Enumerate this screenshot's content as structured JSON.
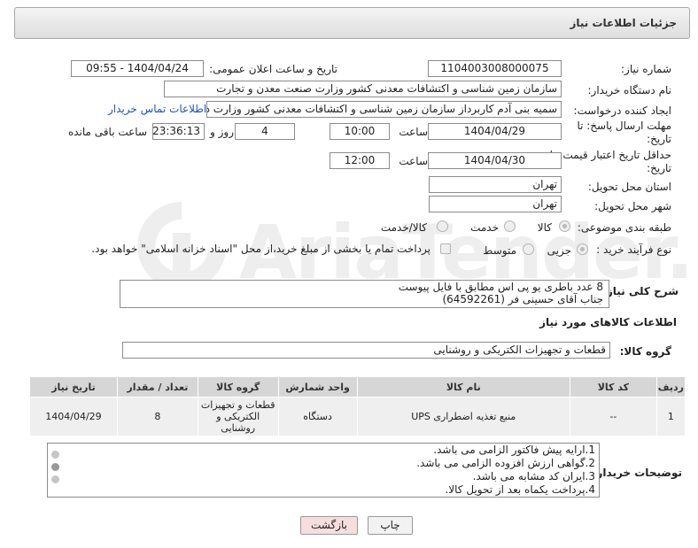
{
  "header": {
    "title": "جزئیات اطلاعات نیاز"
  },
  "labels": {
    "need_number": "شماره نیاز:",
    "announce_datetime": "تاریخ و ساعت اعلان عمومی:",
    "buyer_org": "نام دستگاه خریدار:",
    "requester": "ایجاد کننده درخواست:",
    "reply_deadline": "مهلت ارسال پاسخ: تا تاریخ:",
    "hour1": "ساعت",
    "day_and": "روز و",
    "remaining": "ساعت باقی مانده",
    "price_validity": "حداقل تاریخ اعتبار قیمت: تا تاریخ:",
    "hour2": "ساعت",
    "province": "استان محل تحویل:",
    "city": "شهر محل تحویل:",
    "category": "طبقه بندی موضوعی:",
    "process_type": "نوع فرآیند خرید :",
    "description": "شرح کلی نیاز:",
    "goods_info": "اطلاعات کالاهای مورد نیاز",
    "goods_group": "گروه کالا:",
    "buyer_notes": "توضیحات خریدار:"
  },
  "values": {
    "need_number": "1104003008000075",
    "announce_datetime": "1404/04/24 - 09:55",
    "buyer_org": "سازمان زمین شناسی و اکتشافات معدنی کشور وزارت صنعت معدن و تجارت",
    "requester": "سمیه بنی آدم کاربرداز سازمان زمین شناسی و اکتشافات معدنی کشور وزارت د",
    "contact_link": "اطلاعات تماس خریدار",
    "reply_date": "1404/04/29",
    "reply_time": "10:00",
    "days": "4",
    "remaining_time": "23:36:13",
    "validity_date": "1404/04/30",
    "validity_time": "12:00",
    "province": "تهران",
    "city": "تهران",
    "goods_group": "قطعات و تجهیزات الکتریکی و روشنایی"
  },
  "category_options": [
    "کالا",
    "خدمت",
    "کالا/خدمت"
  ],
  "process_options": [
    "جزیی",
    "متوسط"
  ],
  "payment_note": "پرداخت تمام یا بخشی از مبلغ خرید،از محل \"اسناد خزانه اسلامی\" خواهد بود.",
  "description_lines": [
    "8 عدد باطری یو پی اس مطابق با فایل پیوست",
    "جناب آقای حسینی فر (64592261)"
  ],
  "table": {
    "headers": [
      "ردیف",
      "کد کالا",
      "نام کالا",
      "واحد شمارش",
      "گروه کالا",
      "تعداد / مقدار",
      "تاریخ نیاز"
    ],
    "rows": [
      [
        "1",
        "--",
        "منبع تغذیه اضطراری UPS",
        "دستگاه",
        "قطعات و تجهیزات الکتریکی و روشنایی",
        "8",
        "1404/04/29"
      ]
    ]
  },
  "notes_lines": [
    "1.ارایه پیش فاکتور الزامی می باشد.",
    "2.گواهی ارزش افزوده الزامی می باشد.",
    "3.ایران کد مشابه می باشد.",
    "4.پرداخت یکماه بعد از تحویل کالا."
  ],
  "buttons": {
    "print": "چاپ",
    "back": "بازگشت"
  },
  "watermark": "AriaTender.neT",
  "colors": {
    "link": "#1a56b8",
    "header_bg": "#e4e4e4",
    "back_button_bg": "#f6dede"
  }
}
